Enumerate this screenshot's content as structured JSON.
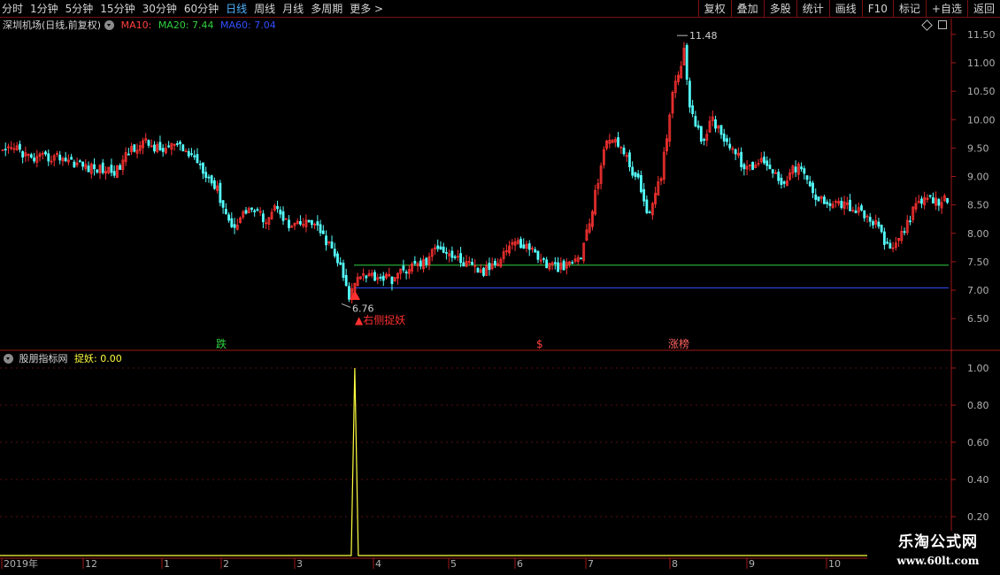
{
  "toolbar": {
    "periods": [
      {
        "label": "分时",
        "active": false
      },
      {
        "label": "1分钟",
        "active": false
      },
      {
        "label": "5分钟",
        "active": false
      },
      {
        "label": "15分钟",
        "active": false
      },
      {
        "label": "30分钟",
        "active": false
      },
      {
        "label": "60分钟",
        "active": false
      },
      {
        "label": "日线",
        "active": true
      },
      {
        "label": "周线",
        "active": false
      },
      {
        "label": "月线",
        "active": false
      },
      {
        "label": "多周期",
        "active": false
      },
      {
        "label": "更多 >",
        "active": false
      }
    ],
    "actions": [
      "复权",
      "叠加",
      "多股",
      "统计",
      "画线",
      "F10",
      "标记",
      "+自选",
      "返回"
    ]
  },
  "main_chart": {
    "stock_name": "深圳机场(日线,前复权)",
    "ma10_label": "MA10:",
    "ma20_label": "MA20: 7.44",
    "ma60_label": "MA60: 7.04",
    "high_label": "11.48",
    "low_label": "6.76",
    "signal_text": "▲右侧捉妖",
    "event_markers": [
      "跌",
      "$",
      "涨榜"
    ],
    "colors": {
      "up": "#ff3232",
      "down": "#54ffff",
      "ma20": "#30d040",
      "ma60": "#3050ff",
      "axis": "#a01818",
      "signal": "#ff3030"
    }
  },
  "indicator": {
    "name": "股朋指标网",
    "value_label": "捉妖: 0.00",
    "color": "#ffff40"
  },
  "x_axis": {
    "labels": [
      "2019年",
      "12",
      "1",
      "2",
      "3",
      "4",
      "5",
      "6",
      "7",
      "8",
      "9",
      "10"
    ]
  },
  "watermark": {
    "title": "乐淘公式网",
    "url": "www.60lt.com"
  },
  "chart_data": [
    {
      "type": "candlestick",
      "title": "深圳机场(日线,前复权)",
      "y_ticks": [
        6.5,
        7.0,
        7.5,
        8.0,
        8.5,
        9.0,
        9.5,
        10.0,
        10.5,
        11.0,
        11.5
      ],
      "ylim": [
        6.2,
        11.7
      ],
      "x_ticks": [
        "2019年",
        "12",
        "1",
        "2",
        "3",
        "4",
        "5",
        "6",
        "7",
        "8",
        "9",
        "10"
      ],
      "series": [
        {
          "name": "MA20",
          "value": 7.44
        },
        {
          "name": "MA60",
          "value": 7.04
        }
      ],
      "high": 11.48,
      "low": 6.76,
      "waypoints": [
        [
          0,
          9.4
        ],
        [
          5,
          9.5
        ],
        [
          10,
          9.3
        ],
        [
          20,
          9.35
        ],
        [
          30,
          9.15
        ],
        [
          40,
          9.1
        ],
        [
          45,
          9.5
        ],
        [
          50,
          9.6
        ],
        [
          55,
          9.45
        ],
        [
          60,
          9.55
        ],
        [
          68,
          9.3
        ],
        [
          75,
          8.75
        ],
        [
          80,
          8.1
        ],
        [
          86,
          8.45
        ],
        [
          92,
          8.25
        ],
        [
          96,
          8.5
        ],
        [
          100,
          8.1
        ],
        [
          108,
          8.2
        ],
        [
          114,
          7.8
        ],
        [
          118,
          7.4
        ],
        [
          121,
          6.85
        ],
        [
          124,
          7.3
        ],
        [
          130,
          7.25
        ],
        [
          136,
          7.2
        ],
        [
          142,
          7.4
        ],
        [
          148,
          7.5
        ],
        [
          152,
          7.8
        ],
        [
          160,
          7.5
        ],
        [
          168,
          7.3
        ],
        [
          174,
          7.6
        ],
        [
          178,
          7.85
        ],
        [
          184,
          7.75
        ],
        [
          190,
          7.45
        ],
        [
          196,
          7.38
        ],
        [
          202,
          7.6
        ],
        [
          206,
          8.4
        ],
        [
          210,
          9.5
        ],
        [
          214,
          9.7
        ],
        [
          218,
          9.3
        ],
        [
          222,
          8.9
        ],
        [
          226,
          8.3
        ],
        [
          230,
          9.0
        ],
        [
          234,
          10.5
        ],
        [
          238,
          11.2
        ],
        [
          240,
          10.3
        ],
        [
          244,
          9.6
        ],
        [
          248,
          10.0
        ],
        [
          252,
          9.7
        ],
        [
          256,
          9.4
        ],
        [
          260,
          9.1
        ],
        [
          266,
          9.3
        ],
        [
          272,
          8.9
        ],
        [
          278,
          9.2
        ],
        [
          284,
          8.6
        ],
        [
          292,
          8.55
        ],
        [
          300,
          8.35
        ],
        [
          306,
          8.1
        ],
        [
          310,
          7.65
        ],
        [
          314,
          8.0
        ],
        [
          318,
          8.4
        ],
        [
          322,
          8.6
        ],
        [
          326,
          8.55
        ],
        [
          330,
          8.6
        ]
      ]
    },
    {
      "type": "line",
      "title": "股朋指标网",
      "series": [
        {
          "name": "捉妖",
          "spike_index": 123,
          "spike_value": 1.0,
          "baseline": 0.0
        }
      ],
      "y_ticks": [
        0.2,
        0.4,
        0.6,
        0.8,
        1.0
      ],
      "ylim": [
        0.0,
        1.05
      ]
    }
  ]
}
